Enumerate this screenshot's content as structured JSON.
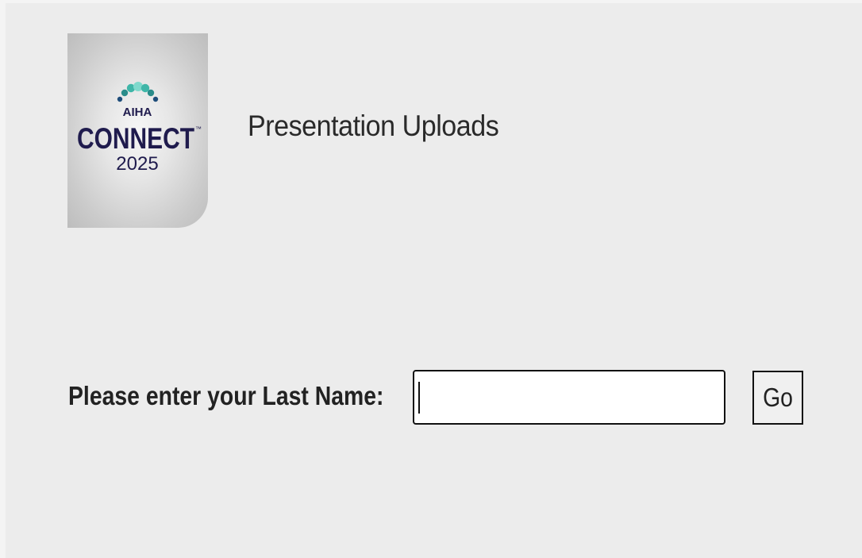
{
  "header": {
    "logo": {
      "org": "AIHA",
      "event": "CONNECT",
      "trademark": "™",
      "year": "2025",
      "colors": {
        "navy": "#1f1b4d",
        "teal_light": "#7fd9cc",
        "teal": "#3fb6a8",
        "teal_dark": "#2a8c8a",
        "blue_dark": "#1e4d7a"
      }
    },
    "title": "Presentation Uploads"
  },
  "form": {
    "label": "Please enter your Last Name:",
    "input": {
      "value": "",
      "placeholder": ""
    },
    "submit_label": "Go"
  }
}
